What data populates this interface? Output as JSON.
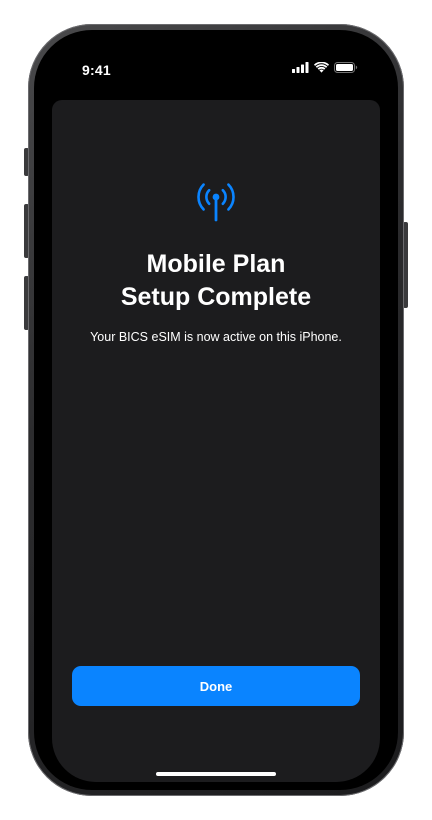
{
  "status_bar": {
    "time": "9:41",
    "icons": [
      "cellular-signal-icon",
      "wifi-icon",
      "battery-icon"
    ]
  },
  "content": {
    "icon": "antenna-signal-icon",
    "title_line1": "Mobile Plan",
    "title_line2": "Setup Complete",
    "subtitle": "Your BICS eSIM is now active on this iPhone."
  },
  "actions": {
    "done_label": "Done"
  },
  "colors": {
    "accent": "#0a84ff",
    "sheet_background": "#1c1c1e",
    "screen_background": "#000000",
    "text": "#ffffff"
  }
}
